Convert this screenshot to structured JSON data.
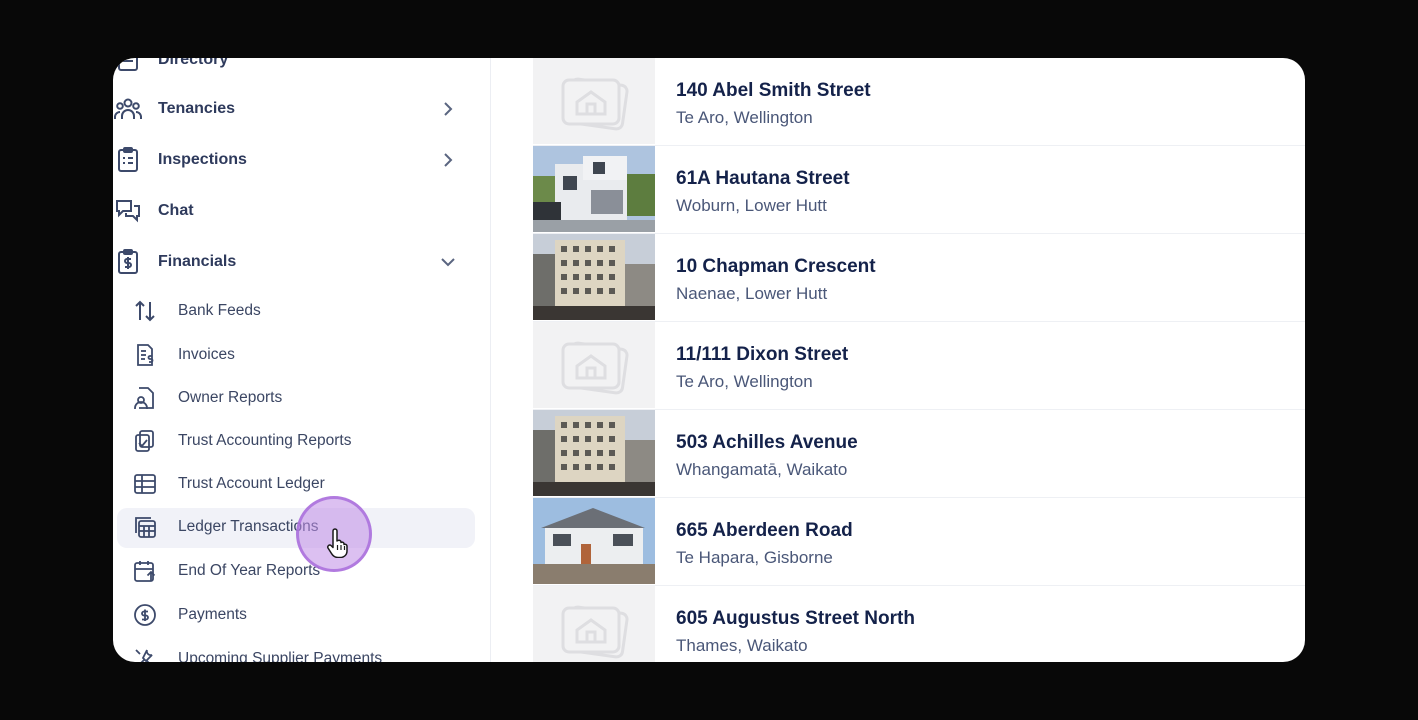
{
  "sidebar": {
    "nav": [
      {
        "label": "Directory",
        "icon": "directory-icon"
      },
      {
        "label": "Tenancies",
        "icon": "tenancies-icon"
      },
      {
        "label": "Inspections",
        "icon": "inspections-icon"
      },
      {
        "label": "Chat",
        "icon": "chat-icon"
      },
      {
        "label": "Financials",
        "icon": "financials-icon"
      }
    ],
    "financials_sub": [
      {
        "label": "Bank Feeds",
        "icon": "bank-feeds-icon"
      },
      {
        "label": "Invoices",
        "icon": "invoices-icon"
      },
      {
        "label": "Owner Reports",
        "icon": "owner-reports-icon"
      },
      {
        "label": "Trust Accounting Reports",
        "icon": "trust-accounting-reports-icon"
      },
      {
        "label": "Trust Account Ledger",
        "icon": "ledger-grid-icon"
      },
      {
        "label": "Ledger Transactions",
        "icon": "ledger-transactions-icon"
      },
      {
        "label": "End Of Year Reports",
        "icon": "end-of-year-reports-icon"
      },
      {
        "label": "Payments",
        "icon": "payments-icon"
      },
      {
        "label": "Upcoming Supplier Payments",
        "icon": "supplier-payments-icon"
      }
    ]
  },
  "properties": [
    {
      "address": "140 Abel Smith Street",
      "suburb": "Te Aro, Wellington"
    },
    {
      "address": "61A Hautana Street",
      "suburb": "Woburn, Lower Hutt"
    },
    {
      "address": "10 Chapman Crescent",
      "suburb": "Naenae, Lower Hutt"
    },
    {
      "address": "11/111 Dixon Street",
      "suburb": "Te Aro, Wellington"
    },
    {
      "address": "503 Achilles Avenue",
      "suburb": "Whangamatā, Waikato"
    },
    {
      "address": "665 Aberdeen Road",
      "suburb": "Te Hapara, Gisborne"
    },
    {
      "address": "605 Augustus Street North",
      "suburb": "Thames, Waikato"
    }
  ]
}
